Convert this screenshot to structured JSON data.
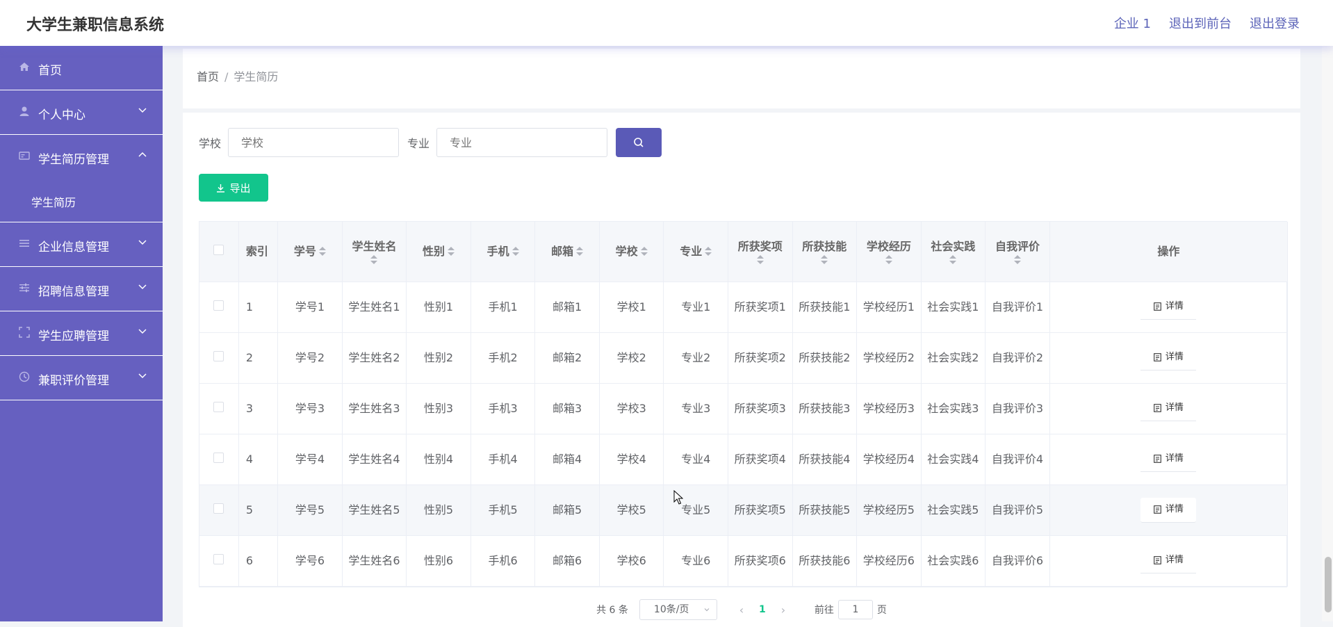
{
  "header": {
    "app_title": "大学生兼职信息系统",
    "links": [
      "企业 1",
      "退出到前台",
      "退出登录"
    ]
  },
  "sidebar": {
    "items": [
      {
        "label": "首页",
        "icon": "home-icon",
        "has_chevron": false
      },
      {
        "label": "个人中心",
        "icon": "user-icon",
        "has_chevron": true
      },
      {
        "label": "学生简历管理",
        "icon": "resume-icon",
        "has_chevron": true,
        "expanded": true
      },
      {
        "label": "企业信息管理",
        "icon": "list-icon",
        "has_chevron": true
      },
      {
        "label": "招聘信息管理",
        "icon": "sliders-icon",
        "has_chevron": true
      },
      {
        "label": "学生应聘管理",
        "icon": "frame-icon",
        "has_chevron": true
      },
      {
        "label": "兼职评价管理",
        "icon": "clock-icon",
        "has_chevron": true
      }
    ],
    "subitem": "学生简历"
  },
  "breadcrumb": {
    "home": "首页",
    "separator": "/",
    "current": "学生简历"
  },
  "search": {
    "school_label": "学校",
    "school_placeholder": "学校",
    "major_label": "专业",
    "major_placeholder": "专业"
  },
  "export_label": "导出",
  "table": {
    "headers": [
      "索引",
      "学号",
      "学生姓名",
      "性别",
      "手机",
      "邮箱",
      "学校",
      "专业",
      "所获奖项",
      "所获技能",
      "学校经历",
      "社会实践",
      "自我评价",
      "操作"
    ],
    "detail_label": "详情",
    "rows": [
      [
        "1",
        "学号1",
        "学生姓名1",
        "性别1",
        "手机1",
        "邮箱1",
        "学校1",
        "专业1",
        "所获奖项1",
        "所获技能1",
        "学校经历1",
        "社会实践1",
        "自我评价1"
      ],
      [
        "2",
        "学号2",
        "学生姓名2",
        "性别2",
        "手机2",
        "邮箱2",
        "学校2",
        "专业2",
        "所获奖项2",
        "所获技能2",
        "学校经历2",
        "社会实践2",
        "自我评价2"
      ],
      [
        "3",
        "学号3",
        "学生姓名3",
        "性别3",
        "手机3",
        "邮箱3",
        "学校3",
        "专业3",
        "所获奖项3",
        "所获技能3",
        "学校经历3",
        "社会实践3",
        "自我评价3"
      ],
      [
        "4",
        "学号4",
        "学生姓名4",
        "性别4",
        "手机4",
        "邮箱4",
        "学校4",
        "专业4",
        "所获奖项4",
        "所获技能4",
        "学校经历4",
        "社会实践4",
        "自我评价4"
      ],
      [
        "5",
        "学号5",
        "学生姓名5",
        "性别5",
        "手机5",
        "邮箱5",
        "学校5",
        "专业5",
        "所获奖项5",
        "所获技能5",
        "学校经历5",
        "社会实践5",
        "自我评价5"
      ],
      [
        "6",
        "学号6",
        "学生姓名6",
        "性别6",
        "手机6",
        "邮箱6",
        "学校6",
        "专业6",
        "所获奖项6",
        "所获技能6",
        "学校经历6",
        "社会实践6",
        "自我评价6"
      ]
    ],
    "highlighted_row": 4
  },
  "pagination": {
    "total": "共 6 条",
    "page_size": "10条/页",
    "current_page": "1",
    "goto_prefix": "前往",
    "goto_value": "1",
    "goto_suffix": "页"
  },
  "colors": {
    "sidebar": "#6660c0",
    "accent": "#5a5ab7",
    "export": "#12c58c"
  }
}
